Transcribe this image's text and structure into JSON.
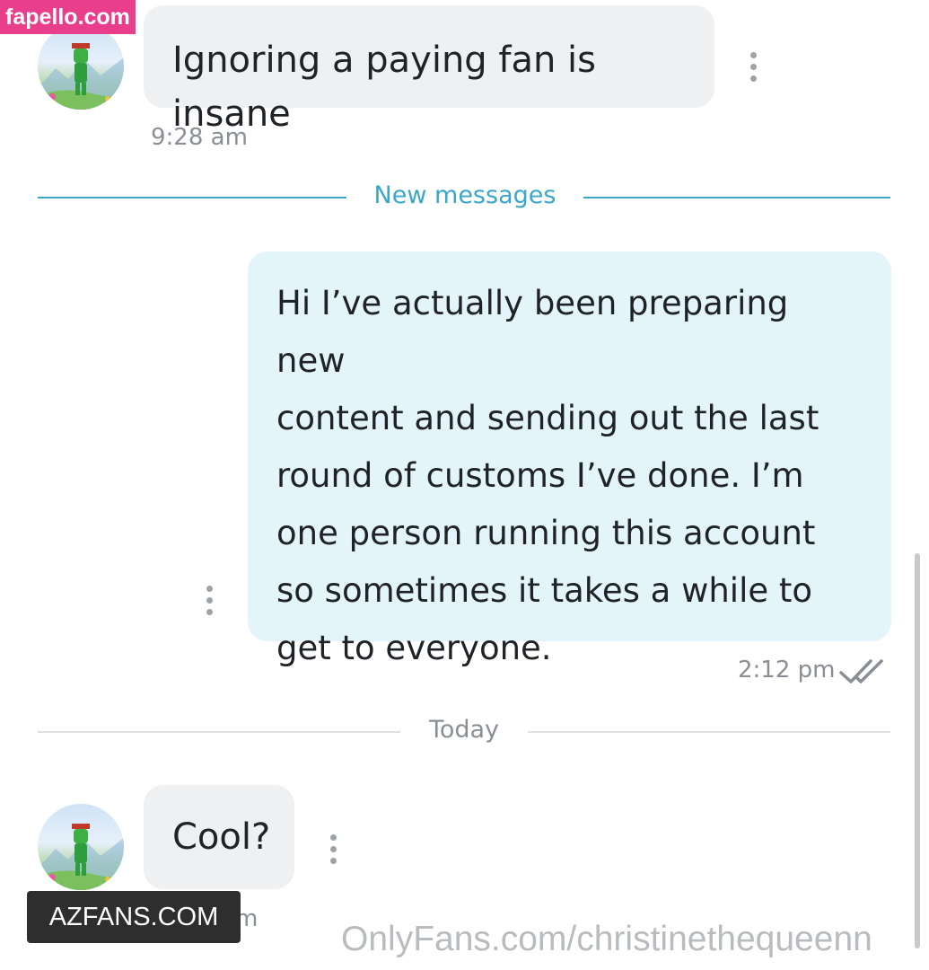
{
  "watermarks": {
    "top_left": "fapello.com",
    "bottom_left": "AZFANS.COM",
    "bottom_right": "OnlyFans.com/christinethequeenn"
  },
  "conversation": {
    "messages": [
      {
        "direction": "incoming",
        "text": "Ignoring a paying fan is insane",
        "time": "9:28 am"
      },
      {
        "direction": "outgoing",
        "lines": [
          "Hi I’ve actually been preparing new",
          "content and sending out the last",
          "round of customs I’ve done. I’m",
          "one person running this account",
          "so sometimes it takes a while to",
          "get to everyone."
        ],
        "time": "2:12 pm",
        "status_icon": "double-check-icon"
      },
      {
        "direction": "incoming",
        "text": "Cool?",
        "time_partial": "m"
      }
    ],
    "separators": {
      "new_messages": "New messages",
      "today": "Today"
    }
  },
  "colors": {
    "incoming_bubble": "#eef0f2",
    "outgoing_bubble": "#e3f4fb",
    "new_messages_accent": "#3aa6c8",
    "divider_gray": "#dfe1e3",
    "watermark_pink": "#e83e8c"
  }
}
